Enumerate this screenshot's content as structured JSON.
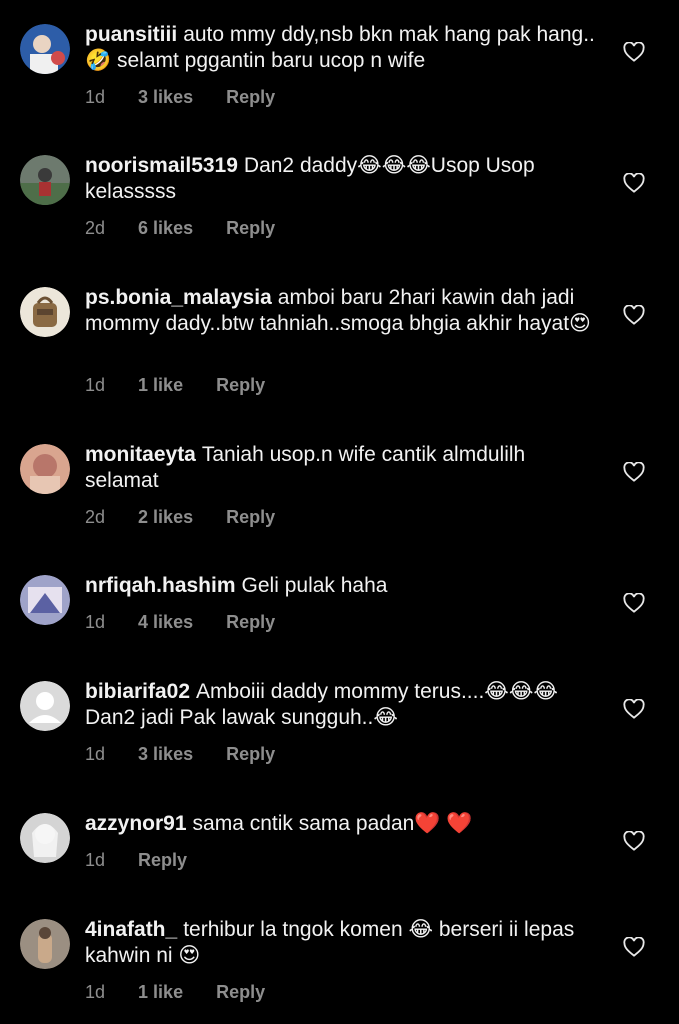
{
  "comments": [
    {
      "username": "puansitiii",
      "text": "auto mmy ddy,nsb bkn mak hang pak hang..🤣 selamt pggantin baru ucop n wife",
      "time": "1d",
      "likes": "3 likes",
      "reply": "Reply",
      "avatar_color": "#3a6fb3"
    },
    {
      "username": "noorismail5319",
      "text": "Dan2 daddy😂😂😂Usop Usop kelasssss",
      "time": "2d",
      "likes": "6 likes",
      "reply": "Reply",
      "avatar_color": "#5a6b5c"
    },
    {
      "username": "ps.bonia_malaysia",
      "text": "amboi baru 2hari kawin dah jadi mommy dady..btw tahniah..smoga bhgia akhir hayat😍",
      "time": "1d",
      "likes": "1 like",
      "reply": "Reply",
      "avatar_color": "#b9a27d"
    },
    {
      "username": "monitaeyta",
      "text": "Taniah usop.n wife cantik almdulilh selamat",
      "time": "2d",
      "likes": "2 likes",
      "reply": "Reply",
      "avatar_color": "#c28a74"
    },
    {
      "username": "nrfiqah.hashim",
      "text": "Geli pulak haha",
      "time": "1d",
      "likes": "4 likes",
      "reply": "Reply",
      "avatar_color": "#7c7fae"
    },
    {
      "username": "bibiarifa02",
      "text": "Amboiii daddy mommy terus....😂😂😂 Dan2 jadi Pak lawak sungguh..😂",
      "time": "1d",
      "likes": "3 likes",
      "reply": "Reply",
      "avatar_color": "#d8d8d8"
    },
    {
      "username": "azzynor91",
      "text": "sama cntik sama padan❤️ ❤️",
      "time": "1d",
      "likes": "",
      "reply": "Reply",
      "avatar_color": "#cfcfcf"
    },
    {
      "username": "4inafath_",
      "text": "terhibur la tngok komen 😂 berseri ii lepas kahwin ni 😍",
      "time": "1d",
      "likes": "1 like",
      "reply": "Reply",
      "avatar_color": "#8a7b6a"
    }
  ]
}
